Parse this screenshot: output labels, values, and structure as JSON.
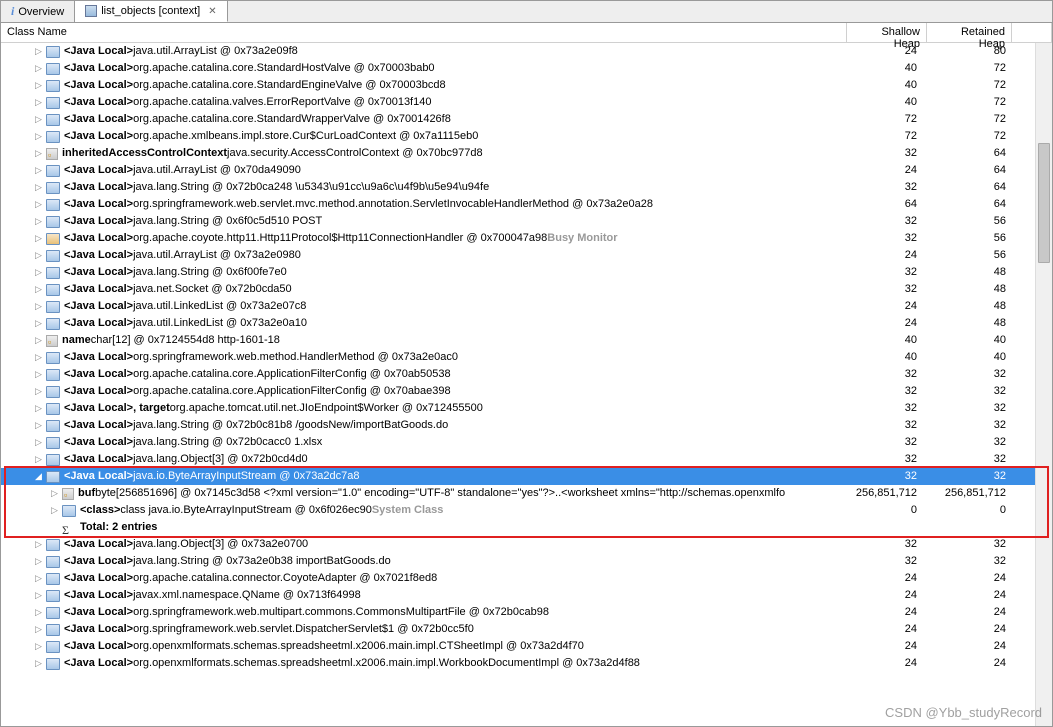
{
  "tabs": [
    {
      "label": "Overview",
      "active": false,
      "icon": "i"
    },
    {
      "label": "list_objects  [context]",
      "active": true,
      "icon": "a"
    }
  ],
  "columns": {
    "c1": "Class Name",
    "c2": "Shallow Heap",
    "c3": "Retained Heap"
  },
  "highlight": {
    "startIndex": 27,
    "endIndex": 30
  },
  "rows": [
    {
      "indent": 2,
      "tw": "closed",
      "icon": "cls",
      "pre": "<Java Local>",
      "text": " java.util.ArrayList @ 0x73a2e09f8",
      "sh": "24",
      "rh": "80"
    },
    {
      "indent": 2,
      "tw": "closed",
      "icon": "cls",
      "pre": "<Java Local>",
      "text": " org.apache.catalina.core.StandardHostValve @ 0x70003bab0",
      "sh": "40",
      "rh": "72"
    },
    {
      "indent": 2,
      "tw": "closed",
      "icon": "cls",
      "pre": "<Java Local>",
      "text": " org.apache.catalina.core.StandardEngineValve @ 0x70003bcd8",
      "sh": "40",
      "rh": "72"
    },
    {
      "indent": 2,
      "tw": "closed",
      "icon": "cls",
      "pre": "<Java Local>",
      "text": " org.apache.catalina.valves.ErrorReportValve @ 0x70013f140",
      "sh": "40",
      "rh": "72"
    },
    {
      "indent": 2,
      "tw": "closed",
      "icon": "cls",
      "pre": "<Java Local>",
      "text": " org.apache.catalina.core.StandardWrapperValve @ 0x7001426f8",
      "sh": "72",
      "rh": "72"
    },
    {
      "indent": 2,
      "tw": "closed",
      "icon": "cls",
      "pre": "<Java Local>",
      "text": " org.apache.xmlbeans.impl.store.Cur$CurLoadContext @ 0x7a1115eb0",
      "sh": "72",
      "rh": "72"
    },
    {
      "indent": 2,
      "tw": "closed",
      "icon": "field",
      "pre": "inheritedAccessControlContext",
      "text": " java.security.AccessControlContext @ 0x70bc977d8",
      "sh": "32",
      "rh": "64"
    },
    {
      "indent": 2,
      "tw": "closed",
      "icon": "cls",
      "pre": "<Java Local>",
      "text": " java.util.ArrayList @ 0x70da49090",
      "sh": "24",
      "rh": "64"
    },
    {
      "indent": 2,
      "tw": "closed",
      "icon": "cls",
      "pre": "<Java Local>",
      "text": " java.lang.String @ 0x72b0ca248  \\u5343\\u91cc\\u9a6c\\u4f9b\\u5e94\\u94fe",
      "sh": "32",
      "rh": "64"
    },
    {
      "indent": 2,
      "tw": "closed",
      "icon": "cls",
      "pre": "<Java Local>",
      "text": " org.springframework.web.servlet.mvc.method.annotation.ServletInvocableHandlerMethod @ 0x73a2e0a28",
      "sh": "64",
      "rh": "64"
    },
    {
      "indent": 2,
      "tw": "closed",
      "icon": "cls",
      "pre": "<Java Local>",
      "text": " java.lang.String @ 0x6f0c5d510  POST",
      "sh": "32",
      "rh": "56"
    },
    {
      "indent": 2,
      "tw": "closed",
      "icon": "busy",
      "pre": "<Java Local>",
      "text": " org.apache.coyote.http11.Http11Protocol$Http11ConnectionHandler @ 0x700047a98 ",
      "post": "Busy Monitor",
      "sh": "32",
      "rh": "56"
    },
    {
      "indent": 2,
      "tw": "closed",
      "icon": "cls",
      "pre": "<Java Local>",
      "text": " java.util.ArrayList @ 0x73a2e0980",
      "sh": "24",
      "rh": "56"
    },
    {
      "indent": 2,
      "tw": "closed",
      "icon": "cls",
      "pre": "<Java Local>",
      "text": " java.lang.String @ 0x6f00fe7e0",
      "sh": "32",
      "rh": "48"
    },
    {
      "indent": 2,
      "tw": "closed",
      "icon": "cls",
      "pre": "<Java Local>",
      "text": " java.net.Socket @ 0x72b0cda50",
      "sh": "32",
      "rh": "48"
    },
    {
      "indent": 2,
      "tw": "closed",
      "icon": "cls",
      "pre": "<Java Local>",
      "text": " java.util.LinkedList @ 0x73a2e07c8",
      "sh": "24",
      "rh": "48"
    },
    {
      "indent": 2,
      "tw": "closed",
      "icon": "cls",
      "pre": "<Java Local>",
      "text": " java.util.LinkedList @ 0x73a2e0a10",
      "sh": "24",
      "rh": "48"
    },
    {
      "indent": 2,
      "tw": "closed",
      "icon": "field",
      "pre": "name",
      "text": " char[12] @ 0x7124554d8  http-1601-18",
      "sh": "40",
      "rh": "40"
    },
    {
      "indent": 2,
      "tw": "closed",
      "icon": "cls",
      "pre": "<Java Local>",
      "text": " org.springframework.web.method.HandlerMethod @ 0x73a2e0ac0",
      "sh": "40",
      "rh": "40"
    },
    {
      "indent": 2,
      "tw": "closed",
      "icon": "cls",
      "pre": "<Java Local>",
      "text": " org.apache.catalina.core.ApplicationFilterConfig @ 0x70ab50538",
      "sh": "32",
      "rh": "32"
    },
    {
      "indent": 2,
      "tw": "closed",
      "icon": "cls",
      "pre": "<Java Local>",
      "text": " org.apache.catalina.core.ApplicationFilterConfig @ 0x70abae398",
      "sh": "32",
      "rh": "32"
    },
    {
      "indent": 2,
      "tw": "closed",
      "icon": "cls",
      "pre": "<Java Local>, target",
      "text": " org.apache.tomcat.util.net.JIoEndpoint$Worker @ 0x712455500",
      "sh": "32",
      "rh": "32"
    },
    {
      "indent": 2,
      "tw": "closed",
      "icon": "cls",
      "pre": "<Java Local>",
      "text": " java.lang.String @ 0x72b0c81b8  /goodsNew/importBatGoods.do",
      "sh": "32",
      "rh": "32"
    },
    {
      "indent": 2,
      "tw": "closed",
      "icon": "cls",
      "pre": "<Java Local>",
      "text": " java.lang.String @ 0x72b0cacc0  1.xlsx",
      "sh": "32",
      "rh": "32"
    },
    {
      "indent": 2,
      "tw": "closed",
      "icon": "cls",
      "pre": "<Java Local>",
      "text": " java.lang.Object[3] @ 0x72b0cd4d0",
      "sh": "32",
      "rh": "32"
    },
    {
      "indent": 2,
      "tw": "open",
      "icon": "cls",
      "pre": "<Java Local>",
      "text": " java.io.ByteArrayInputStream @ 0x73a2dc7a8",
      "sh": "32",
      "rh": "32",
      "hl": true
    },
    {
      "indent": 3,
      "tw": "closed",
      "icon": "field",
      "pre": "buf",
      "text": " byte[256851696] @ 0x7145c3d58  <?xml version=\"1.0\" encoding=\"UTF-8\" standalone=\"yes\"?>..<worksheet xmlns=\"http://schemas.openxmlfo",
      "sh": "256,851,712",
      "rh": "256,851,712"
    },
    {
      "indent": 3,
      "tw": "closed",
      "icon": "cls",
      "pre": "<class>",
      "text": " class java.io.ByteArrayInputStream @ 0x6f026ec90 ",
      "post": "System Class",
      "sh": "0",
      "rh": "0"
    },
    {
      "indent": 3,
      "tw": "none",
      "icon": "sum",
      "pre": "Total: 2 entries",
      "text": "",
      "sh": "",
      "rh": "",
      "sum": true
    },
    {
      "indent": 2,
      "tw": "closed",
      "icon": "cls",
      "pre": "<Java Local>",
      "text": " java.lang.Object[3] @ 0x73a2e0700",
      "sh": "32",
      "rh": "32"
    },
    {
      "indent": 2,
      "tw": "closed",
      "icon": "cls",
      "pre": "<Java Local>",
      "text": " java.lang.String @ 0x73a2e0b38  importBatGoods.do",
      "sh": "32",
      "rh": "32"
    },
    {
      "indent": 2,
      "tw": "closed",
      "icon": "cls",
      "pre": "<Java Local>",
      "text": " org.apache.catalina.connector.CoyoteAdapter @ 0x7021f8ed8",
      "sh": "24",
      "rh": "24"
    },
    {
      "indent": 2,
      "tw": "closed",
      "icon": "cls",
      "pre": "<Java Local>",
      "text": " javax.xml.namespace.QName @ 0x713f64998",
      "sh": "24",
      "rh": "24"
    },
    {
      "indent": 2,
      "tw": "closed",
      "icon": "cls",
      "pre": "<Java Local>",
      "text": " org.springframework.web.multipart.commons.CommonsMultipartFile @ 0x72b0cab98",
      "sh": "24",
      "rh": "24"
    },
    {
      "indent": 2,
      "tw": "closed",
      "icon": "cls",
      "pre": "<Java Local>",
      "text": " org.springframework.web.servlet.DispatcherServlet$1 @ 0x72b0cc5f0",
      "sh": "24",
      "rh": "24"
    },
    {
      "indent": 2,
      "tw": "closed",
      "icon": "cls",
      "pre": "<Java Local>",
      "text": " org.openxmlformats.schemas.spreadsheetml.x2006.main.impl.CTSheetImpl @ 0x73a2d4f70",
      "sh": "24",
      "rh": "24"
    },
    {
      "indent": 2,
      "tw": "closed",
      "icon": "cls",
      "pre": "<Java Local>",
      "text": " org.openxmlformats.schemas.spreadsheetml.x2006.main.impl.WorkbookDocumentImpl @ 0x73a2d4f88",
      "sh": "24",
      "rh": "24"
    }
  ],
  "watermark": "CSDN @Ybb_studyRecord"
}
